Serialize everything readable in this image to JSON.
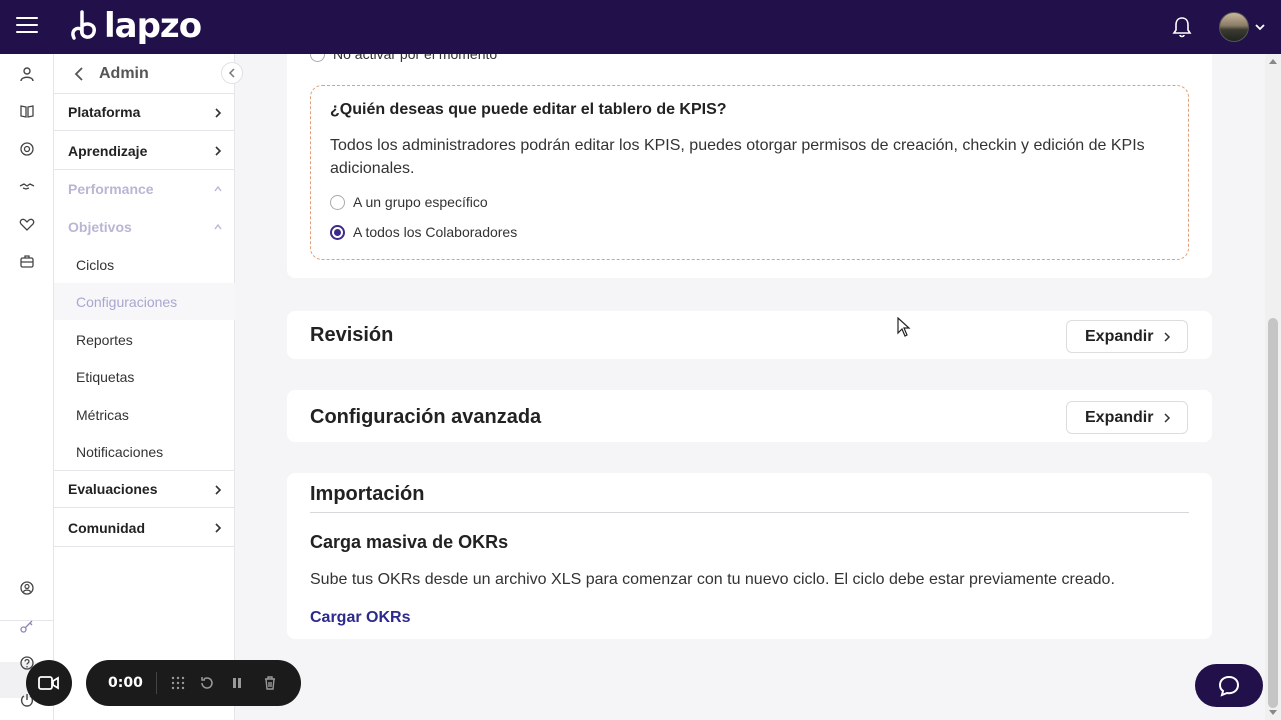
{
  "app": {
    "logo_text": "lapzo"
  },
  "sidebar": {
    "title": "Admin",
    "sections": [
      {
        "label": "Plataforma"
      },
      {
        "label": "Aprendizaje"
      },
      {
        "label": "Performance"
      },
      {
        "label": "Objetivos"
      }
    ],
    "objetivos_items": [
      "Ciclos",
      "Configuraciones",
      "Reportes",
      "Etiquetas",
      "Métricas",
      "Notificaciones"
    ],
    "active_item": "Configuraciones",
    "bottom_sections": [
      {
        "label": "Evaluaciones"
      },
      {
        "label": "Comunidad"
      }
    ]
  },
  "main": {
    "top_radio_partial": "No activar por el momento",
    "kpis": {
      "question": "¿Quién deseas que puede editar el tablero de KPIS?",
      "description": "Todos los administradores podrán editar los KPIS, puedes otorgar permisos de creación, checkin y edición de KPIs adicionales.",
      "options": [
        {
          "label": "A un grupo específico",
          "checked": false
        },
        {
          "label": "A todos los Colaboradores",
          "checked": true
        }
      ]
    },
    "revision": {
      "title": "Revisión",
      "button": "Expandir"
    },
    "avanzada": {
      "title": "Configuración avanzada",
      "button": "Expandir"
    },
    "importacion": {
      "title": "Importación",
      "subtitle": "Carga masiva de OKRs",
      "text": "Sube tus OKRs desde un archivo XLS para comenzar con tu nuevo ciclo. El ciclo debe estar previamente creado.",
      "link": "Cargar OKRs"
    }
  },
  "recorder": {
    "time": "0:00"
  },
  "colors": {
    "topbar": "#22104a",
    "accent": "#3d2a8a",
    "link": "#2c2a8c",
    "dashed_border": "#e2a07a"
  }
}
